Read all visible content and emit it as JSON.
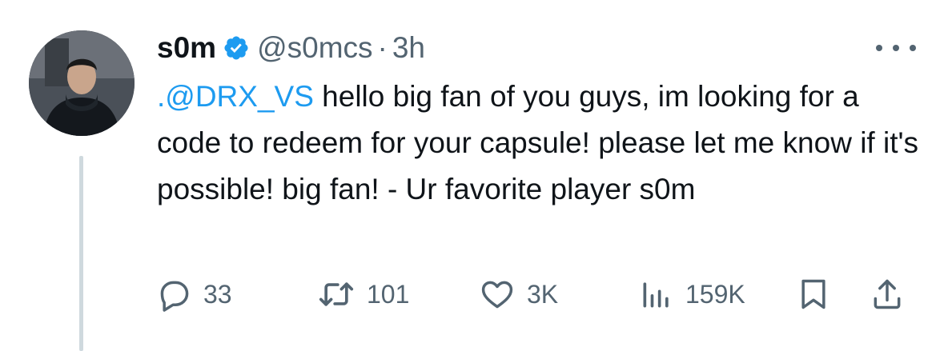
{
  "tweet": {
    "display_name": "s0m",
    "handle": "@s0mcs",
    "separator": "·",
    "time": "3h",
    "verified_icon": "verified-badge-icon",
    "more_icon": "more-options-icon",
    "text": {
      "mention": ".@DRX_VS",
      "body": " hello big fan of you guys, im looking for a code to redeem for your capsule! please let me know if it's possible! big fan! - Ur favorite player s0m"
    },
    "avatar": "profile-avatar"
  },
  "actions": {
    "replies": {
      "icon": "reply-icon",
      "count": "33"
    },
    "reposts": {
      "icon": "repost-icon",
      "count": "101"
    },
    "likes": {
      "icon": "like-icon",
      "count": "3K"
    },
    "views": {
      "icon": "views-icon",
      "count": "159K"
    },
    "bookmark": {
      "icon": "bookmark-icon"
    },
    "share": {
      "icon": "share-icon"
    }
  },
  "colors": {
    "text_primary": "#0f1419",
    "text_secondary": "#536471",
    "accent": "#1d9bf0",
    "thread_line": "#cfd9de"
  }
}
